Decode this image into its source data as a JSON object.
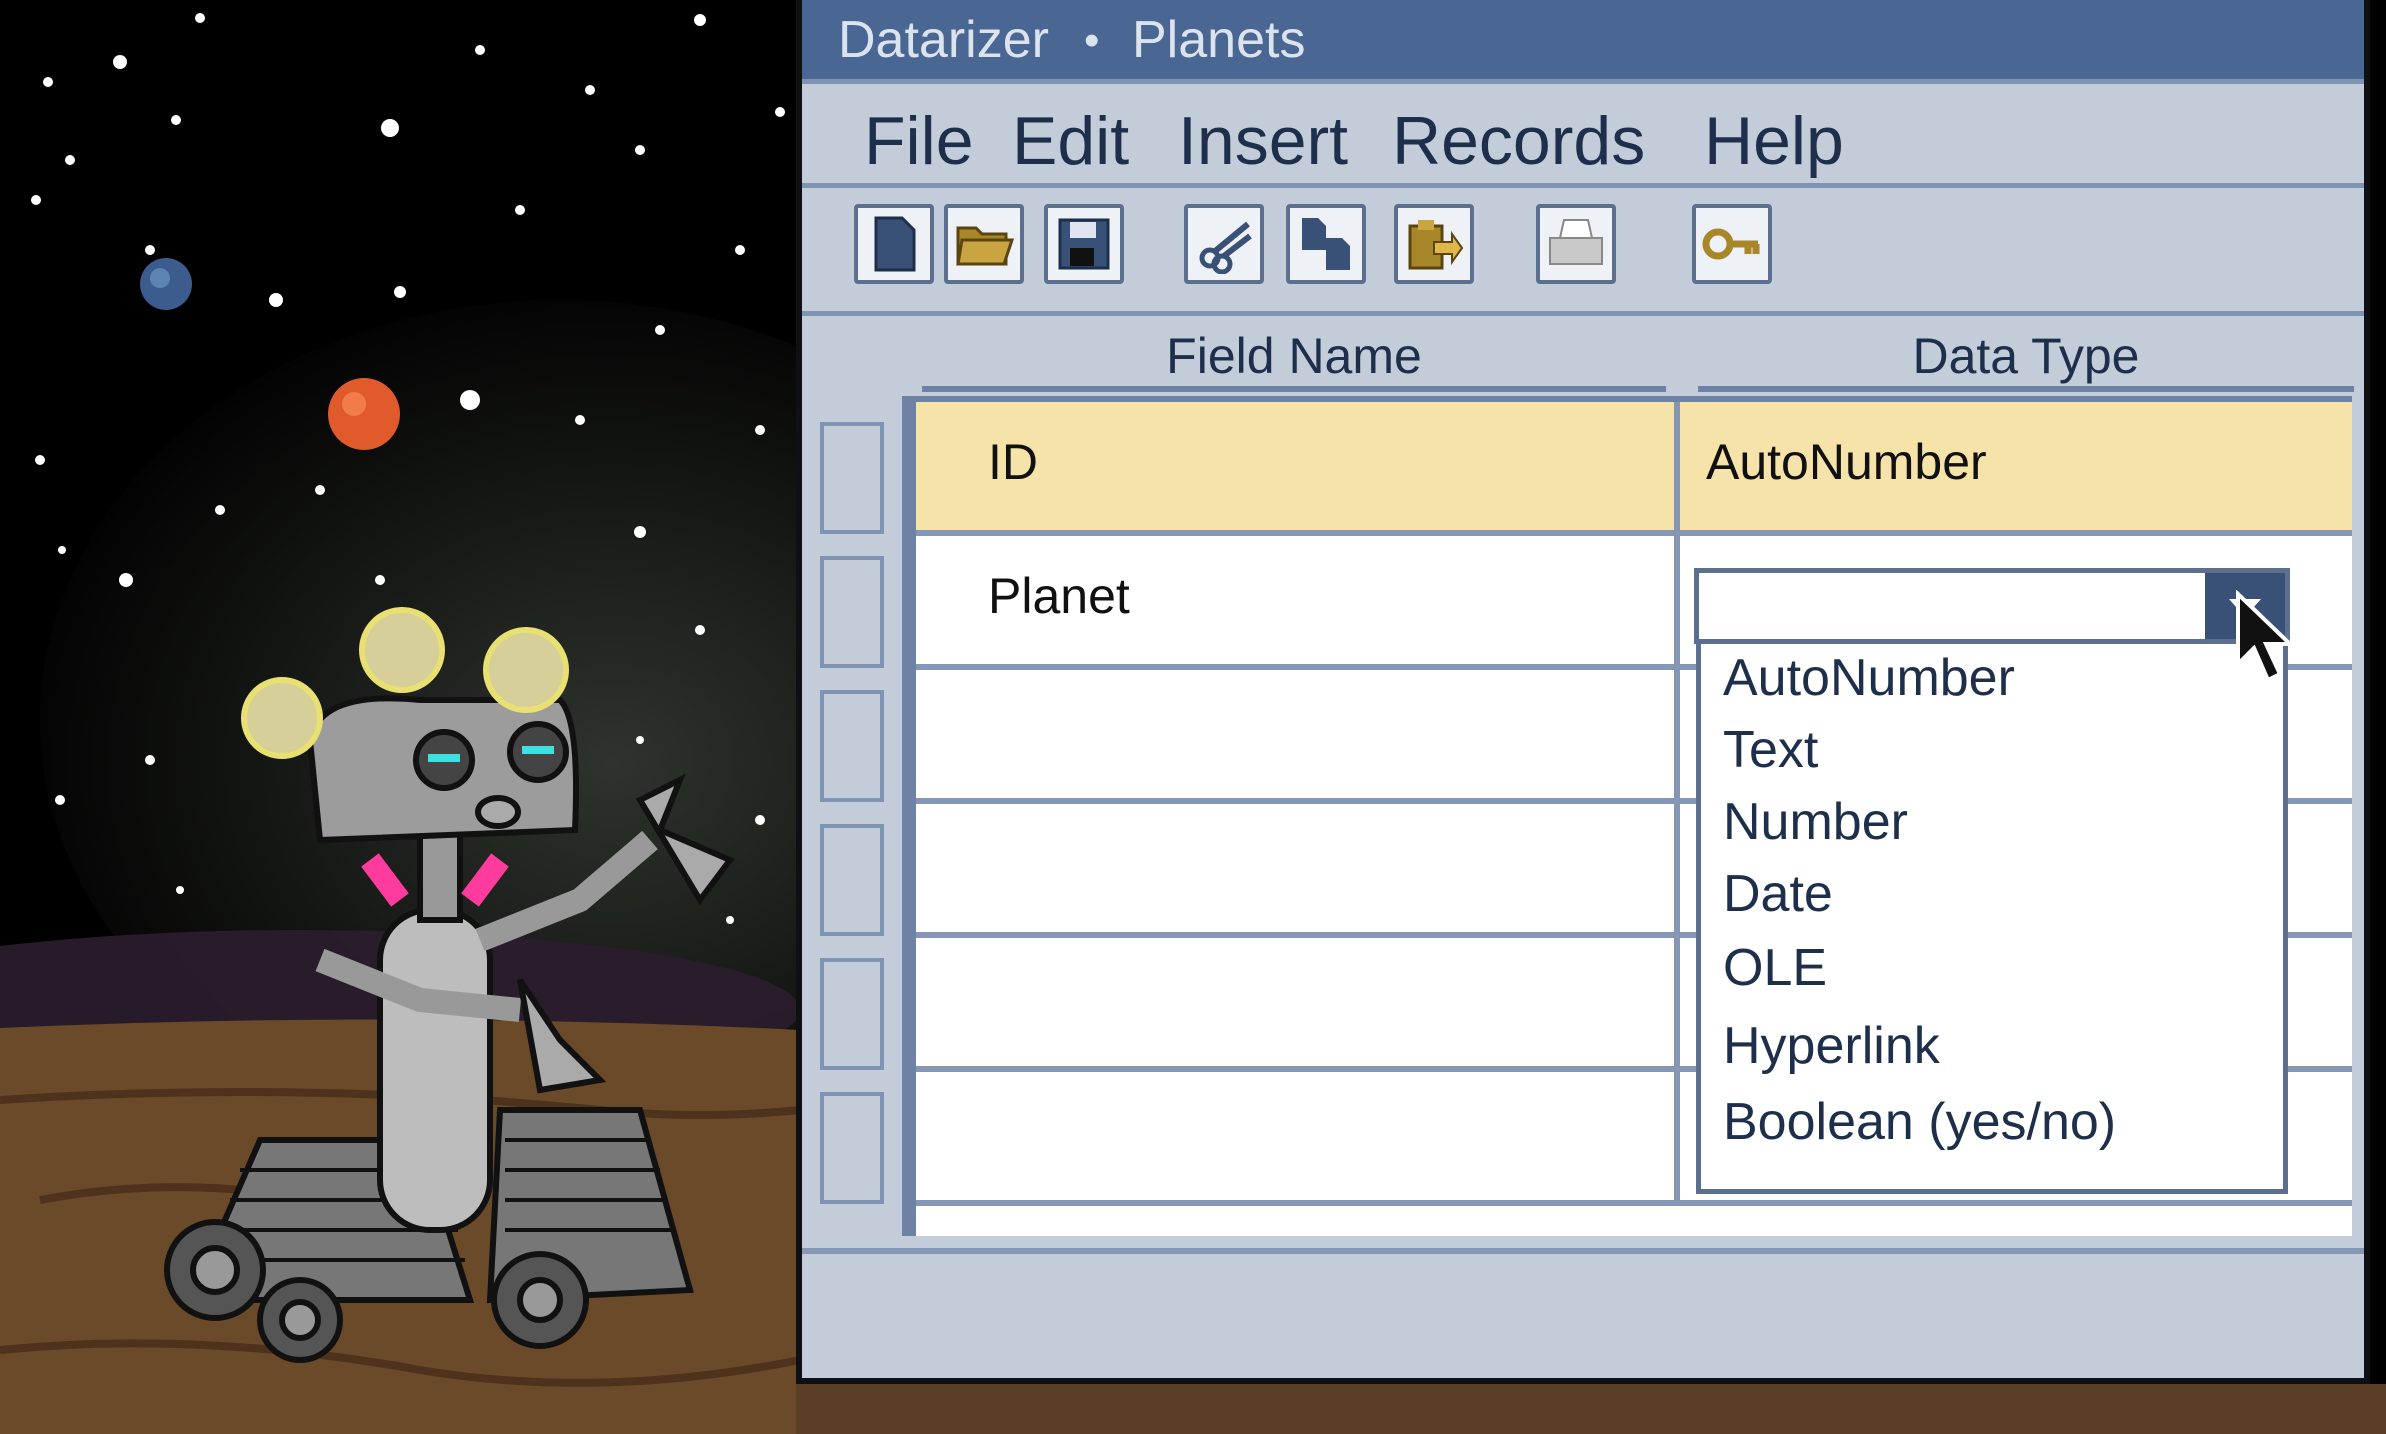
{
  "window": {
    "app_name": "Datarizer",
    "separator": "•",
    "document": "Planets"
  },
  "menu": [
    "File",
    "Edit",
    "Insert",
    "Records",
    "Help"
  ],
  "toolbar": [
    "new-file-icon",
    "open-folder-icon",
    "save-icon",
    "cut-icon",
    "copy-icon",
    "paste-icon",
    "print-icon",
    "key-icon"
  ],
  "table": {
    "headers": [
      "Field Name",
      "Data Type"
    ],
    "rows": [
      {
        "field": "ID",
        "type": "AutoNumber"
      },
      {
        "field": "Planet",
        "type": ""
      },
      {
        "field": "",
        "type": ""
      },
      {
        "field": "",
        "type": ""
      },
      {
        "field": "",
        "type": ""
      },
      {
        "field": "",
        "type": ""
      }
    ]
  },
  "dropdown": {
    "value": "",
    "options": [
      "AutoNumber",
      "Text",
      "Number",
      "Date",
      "OLE",
      "Hyperlink",
      "Boolean (yes/no)"
    ]
  },
  "colors": {
    "titlebar": "#4a6692",
    "window": "#c3ccd9",
    "active_row": "#f5e3aa",
    "accent": "#3a5177"
  }
}
